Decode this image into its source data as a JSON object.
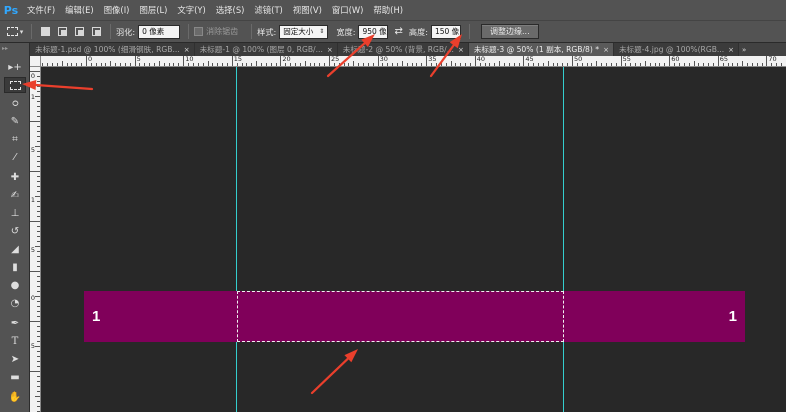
{
  "app": {
    "logo": "Ps"
  },
  "menu": [
    "文件(F)",
    "编辑(E)",
    "图像(I)",
    "图层(L)",
    "文字(Y)",
    "选择(S)",
    "滤镜(T)",
    "视图(V)",
    "窗口(W)",
    "帮助(H)"
  ],
  "options": {
    "tool_icon": "rectangular-marquee-icon",
    "feather_label": "羽化:",
    "feather_value": "0 像素",
    "antialias_label": "消除锯齿",
    "style_label": "样式:",
    "style_value": "固定大小",
    "width_label": "宽度:",
    "width_value": "950 像",
    "height_label": "高度:",
    "height_value": "150 像",
    "refine_edge_label": "调整边缘..."
  },
  "tabs": [
    {
      "label": "未标题-1.psd @ 100% (细滑钢肤, RGB...",
      "active": false
    },
    {
      "label": "未标题-1 @ 100% (图层 0, RGB/...",
      "active": false
    },
    {
      "label": "未标题-2 @ 50% (背景, RGB/...",
      "active": false
    },
    {
      "label": "未标题-3 @ 50% (1 副本, RGB/8) *",
      "active": true
    },
    {
      "label": "未标题-4.jpg @ 100%(RGB...",
      "active": false
    }
  ],
  "tab_close": "×",
  "tab_overflow": "»",
  "ruler_top_labels": [
    "0",
    "5",
    "10",
    "15",
    "20",
    "25",
    "30",
    "35",
    "40",
    "45",
    "50",
    "55",
    "60",
    "65",
    "70"
  ],
  "ruler_left_labels": [
    "0",
    "1",
    "5",
    "1",
    "5",
    "0",
    "5"
  ],
  "canvas": {
    "bar_color": "#80005a",
    "bar_label_left": "1",
    "bar_label_right": "1",
    "guide_color": "#35e0e0",
    "arrow_color": "#ea3f2c"
  },
  "toolbar_icons": [
    "move-icon",
    "rectangular-marquee-icon",
    "lasso-icon",
    "quick-selection-icon",
    "crop-icon",
    "eyedropper-icon",
    "healing-brush-icon",
    "brush-icon",
    "clone-stamp-icon",
    "history-brush-icon",
    "eraser-icon",
    "gradient-icon",
    "blur-icon",
    "dodge-icon",
    "pen-icon",
    "type-icon",
    "path-selection-icon",
    "shape-icon",
    "hand-icon"
  ]
}
